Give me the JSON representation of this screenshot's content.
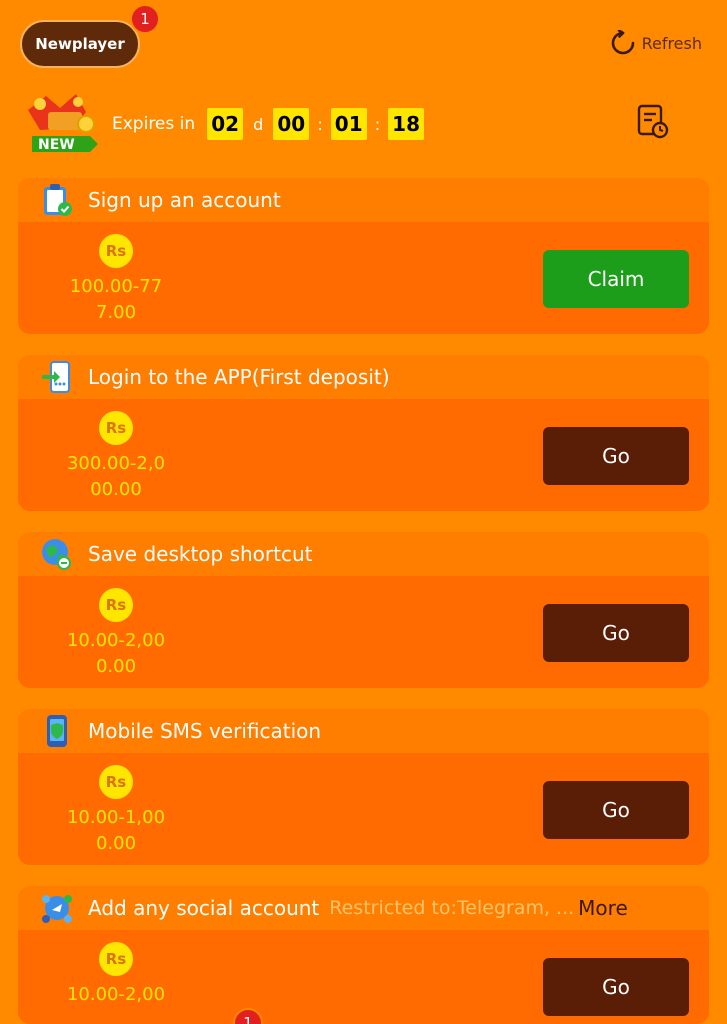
{
  "header": {
    "tab_label": "Newplayer",
    "tab_badge": "1",
    "refresh_label": "Refresh"
  },
  "timer": {
    "expires_label": "Expires in",
    "days": "02",
    "day_unit": "d",
    "hours": "00",
    "minutes": "01",
    "seconds": "18",
    "sep": ":",
    "gift_badge": "NEW"
  },
  "currency": "Rs",
  "tasks": [
    {
      "title": "Sign up an account",
      "amount_line1": "100.00-77",
      "amount_line2": "7.00",
      "button": "Claim"
    },
    {
      "title": "Login to the APP(First deposit)",
      "amount_line1": "300.00-2,0",
      "amount_line2": "00.00",
      "button": "Go"
    },
    {
      "title": "Save desktop shortcut",
      "amount_line1": "10.00-2,00",
      "amount_line2": "0.00",
      "button": "Go"
    },
    {
      "title": "Mobile SMS verification",
      "amount_line1": "10.00-1,00",
      "amount_line2": "0.00",
      "button": "Go"
    },
    {
      "title": "Add any social account",
      "restriction": "Restricted to:Telegram, ...",
      "more": "More",
      "amount_line1": "10.00-2,00",
      "button": "Go"
    }
  ],
  "footer": {
    "badge": "1"
  },
  "colors": {
    "background": "#FF8A00",
    "card": "#FF6B00",
    "go_button": "#5A1D06",
    "claim_button": "#1D9E1A",
    "timer_box": "#FFE600",
    "amount": "#FFE600"
  }
}
